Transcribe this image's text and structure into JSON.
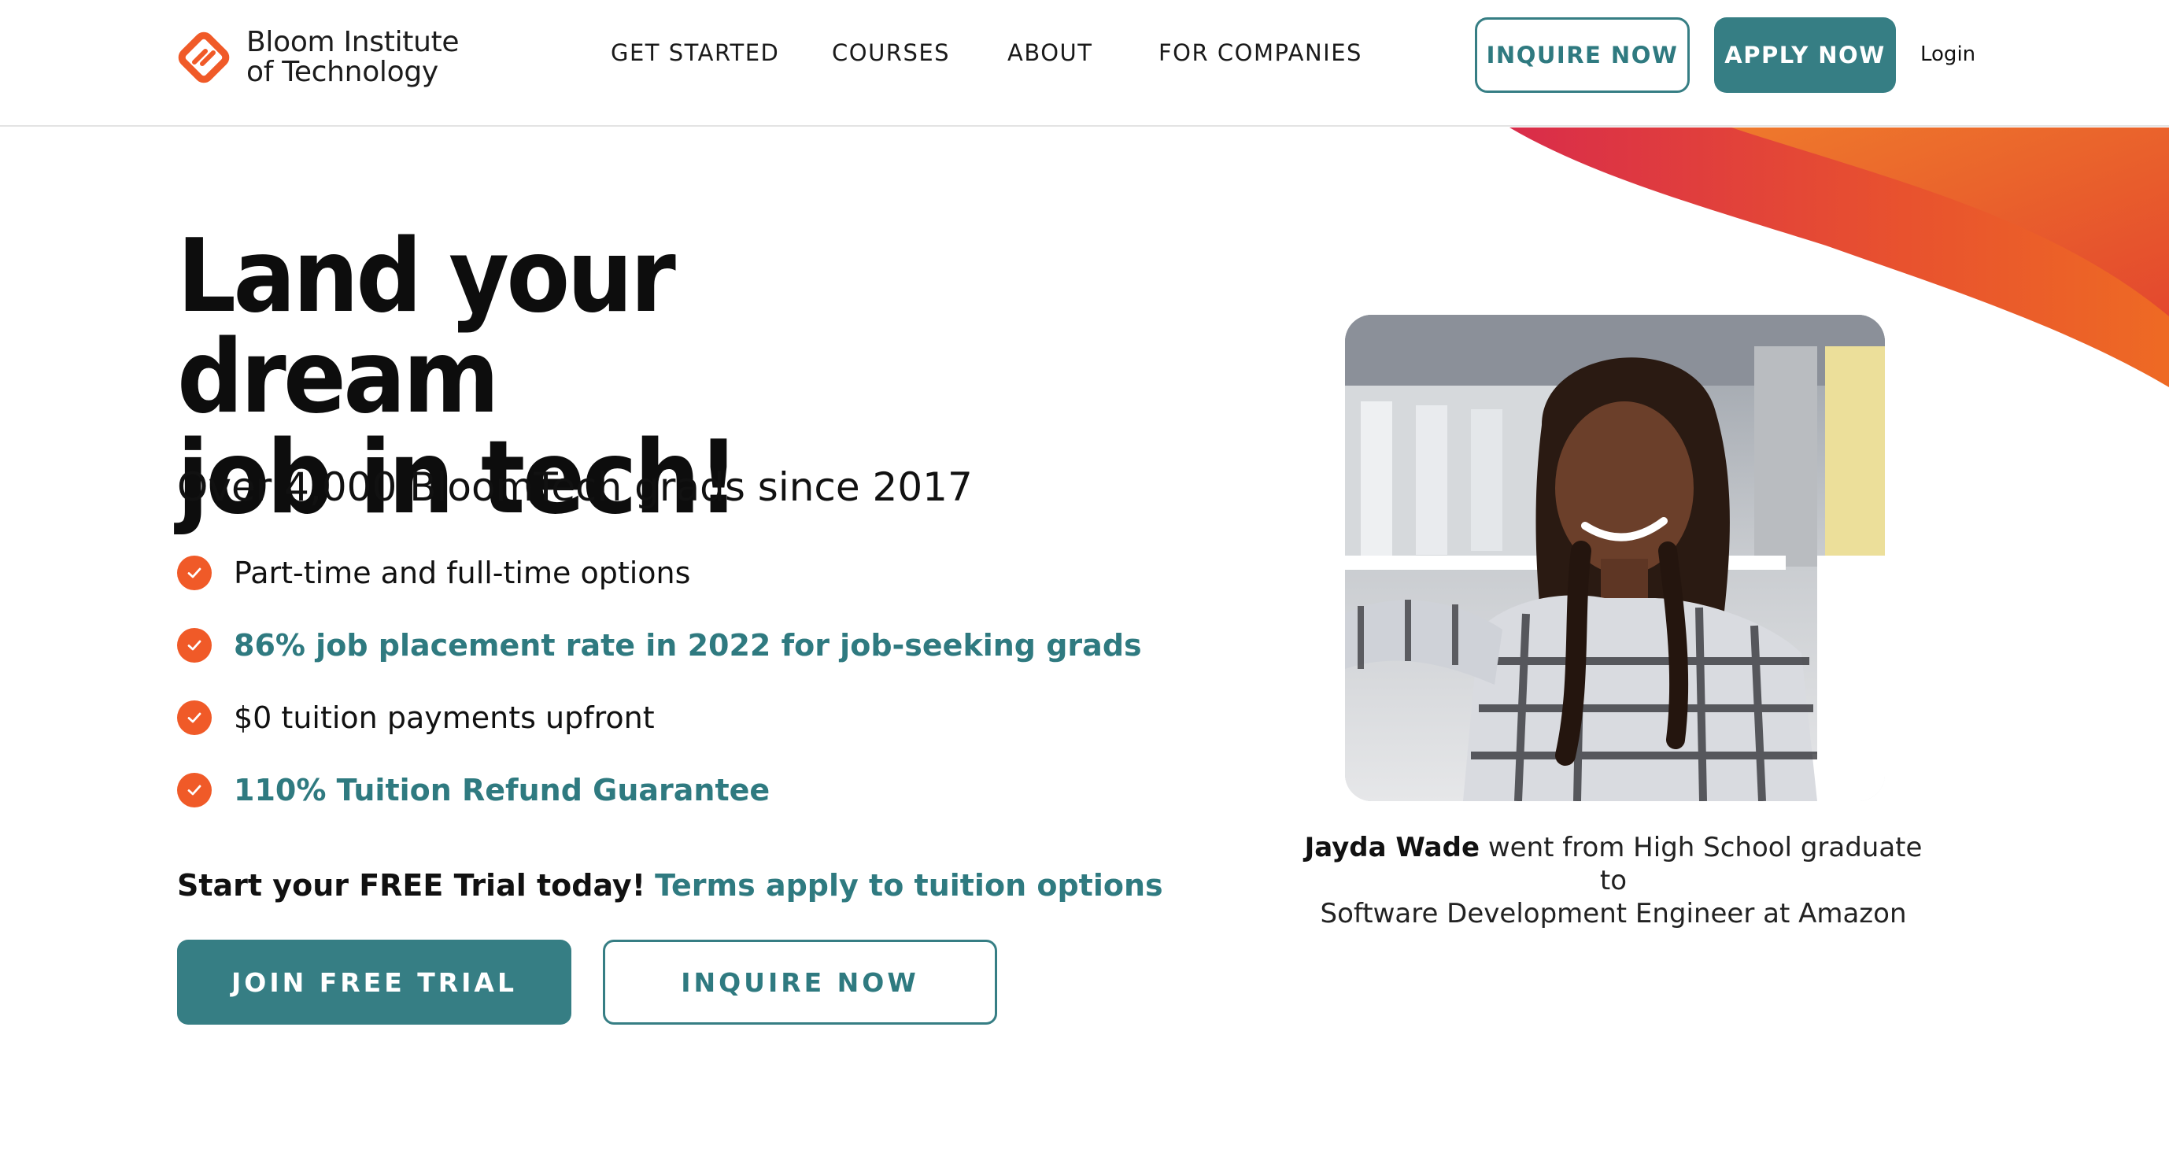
{
  "brand": {
    "name_line1": "Bloom Institute",
    "name_line2": "of Technology",
    "accent_color": "#f05a28",
    "primary_color": "#367e84"
  },
  "nav": {
    "items": [
      {
        "label": "GET STARTED"
      },
      {
        "label": "COURSES"
      },
      {
        "label": "ABOUT"
      },
      {
        "label": "FOR COMPANIES"
      }
    ],
    "inquire_label": "INQUIRE NOW",
    "apply_label": "APPLY NOW",
    "login_label": "Login"
  },
  "hero": {
    "title_line1": "Land your dream",
    "title_line2": "job in tech!",
    "subtitle": "Over 4,000 BloomTech grads since 2017",
    "features": [
      {
        "text": "Part-time and full-time options",
        "icon": "check-circle-icon"
      },
      {
        "text": "86% job placement rate in 2022 for job-seeking grads",
        "icon": "check-circle-icon"
      },
      {
        "text": "$0 tuition payments upfront",
        "icon": "check-circle-icon"
      },
      {
        "text": "110% Tuition Refund Guarantee",
        "icon": "check-circle-icon"
      }
    ],
    "trial_lead": "Start your FREE Trial today!",
    "trial_terms": "Terms apply to tuition options",
    "join_label": "JOIN FREE TRIAL",
    "inquire_label": "INQUIRE NOW"
  },
  "testimonial": {
    "name": "Jayda Wade",
    "caption_rest_line1": " went from High School graduate to",
    "caption_line2": "Software Development Engineer at Amazon"
  }
}
